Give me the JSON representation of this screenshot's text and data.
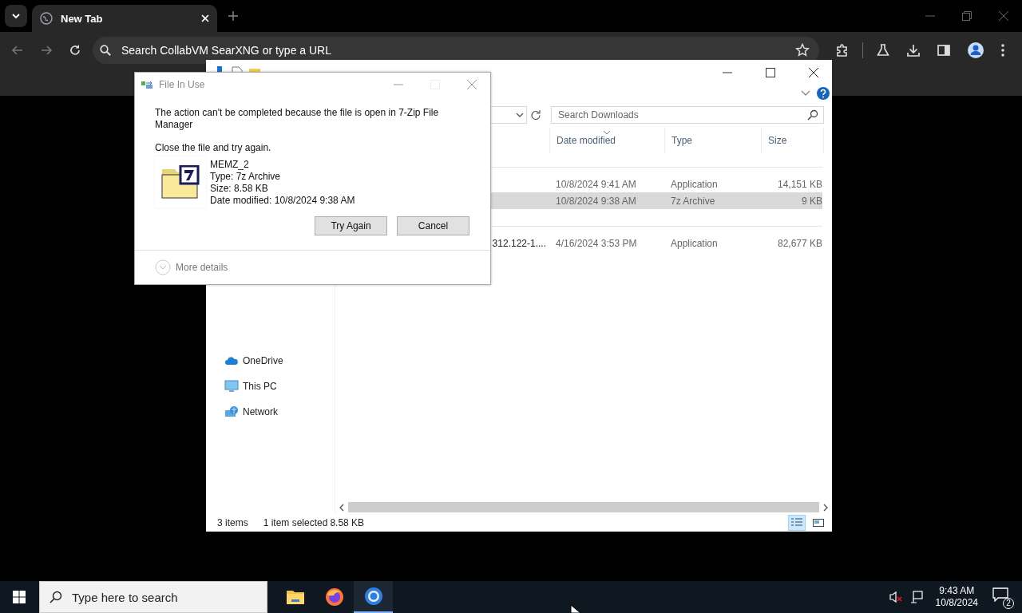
{
  "browser": {
    "tab": {
      "title": "New Tab",
      "selected": true
    },
    "omnibox": {
      "placeholder": "Search CollabVM SearXNG or type a URL"
    }
  },
  "explorer": {
    "search": {
      "placeholder": "Search Downloads"
    },
    "columns": [
      "Date modified",
      "Type",
      "Size"
    ],
    "groups": [
      {
        "rows": [
          {
            "date": "10/8/2024 9:41 AM",
            "type": "Application",
            "size": "14,151 KB",
            "selected": false
          },
          {
            "date": "10/8/2024 9:38 AM",
            "type": "7z Archive",
            "size": "9 KB",
            "selected": true
          }
        ]
      },
      {
        "rows": [
          {
            "name": "312.122-1....",
            "date": "4/16/2024 3:53 PM",
            "type": "Application",
            "size": "82,677 KB",
            "selected": false
          }
        ]
      }
    ],
    "nav": [
      {
        "label": "OneDrive"
      },
      {
        "label": "This PC"
      },
      {
        "label": "Network"
      }
    ],
    "status": {
      "count": "3 items",
      "selection": "1 item selected",
      "size": "8.58 KB"
    },
    "views": [
      {
        "selected": true
      },
      {
        "selected": false
      }
    ]
  },
  "dialog": {
    "title": "File In Use",
    "message": "The action can't be completed because the file is open in 7-Zip File Manager",
    "instruction": "Close the file and try again.",
    "file": {
      "name": "MEMZ_2",
      "details": [
        "Type: 7z Archive",
        "Size: 8.58 KB",
        "Date modified: 10/8/2024 9:38 AM"
      ]
    },
    "buttons": [
      "Try Again",
      "Cancel"
    ],
    "more": "More details"
  },
  "taskbar": {
    "search": {
      "placeholder": "Type here to search"
    },
    "clock": {
      "time": "9:43 AM",
      "date": "10/8/2024"
    },
    "notifications": "2"
  }
}
